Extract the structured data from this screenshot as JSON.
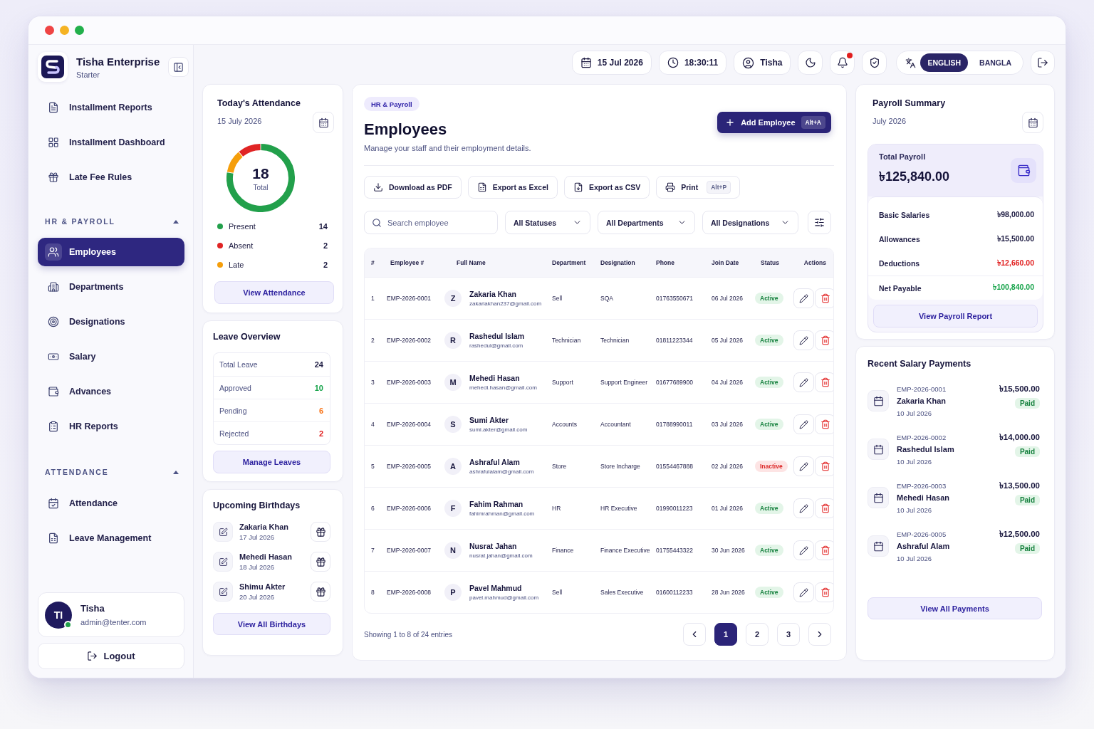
{
  "sidebar": {
    "brand": {
      "name": "Tisha Enterprise",
      "plan": "Starter"
    },
    "items": [
      {
        "label": "Installment Reports",
        "selected": false
      },
      {
        "label": "Installment Dashboard",
        "selected": false
      },
      {
        "label": "Late Fee Rules",
        "selected": false
      }
    ],
    "sections": [
      {
        "title": "HR & PAYROLL",
        "expanded": true,
        "items": [
          {
            "label": "Employees",
            "selected": true
          },
          {
            "label": "Departments",
            "selected": false
          },
          {
            "label": "Designations",
            "selected": false
          },
          {
            "label": "Salary",
            "selected": false
          },
          {
            "label": "Advances",
            "selected": false
          },
          {
            "label": "HR Reports",
            "selected": false
          }
        ]
      },
      {
        "title": "ATTENDANCE",
        "expanded": true,
        "items": [
          {
            "label": "Attendance",
            "selected": false
          },
          {
            "label": "Leave Management",
            "selected": false
          }
        ]
      }
    ],
    "user": {
      "initials": "TI",
      "name": "Tisha",
      "email": "admin@tenter.com",
      "online": true
    },
    "logout": "Logout"
  },
  "header": {
    "date": "15 Jul 2026",
    "time": "18:30:11",
    "user": "Tisha",
    "notifications_unread": true,
    "languages": [
      {
        "label": "ENGLISH",
        "selected": true
      },
      {
        "label": "BANGLA",
        "selected": false
      }
    ]
  },
  "attendance": {
    "title": "Today's Attendance",
    "date": "15 July 2026",
    "total": "18",
    "total_label": "Total",
    "items": [
      {
        "label": "Present",
        "value": "14",
        "color": "#22a04b"
      },
      {
        "label": "Absent",
        "value": "2",
        "color": "#e02424"
      },
      {
        "label": "Late",
        "value": "2",
        "color": "#f59e0b"
      }
    ],
    "button": "View Attendance"
  },
  "leave": {
    "title": "Leave Overview",
    "rows": [
      {
        "label": "Total Leave",
        "value": "24",
        "color": "#1b1940"
      },
      {
        "label": "Approved",
        "value": "10",
        "color": "#16a34a"
      },
      {
        "label": "Pending",
        "value": "6",
        "color": "#f97316"
      },
      {
        "label": "Rejected",
        "value": "2",
        "color": "#e11d1d"
      }
    ],
    "button": "Manage Leaves"
  },
  "birthdays": {
    "title": "Upcoming Birthdays",
    "items": [
      {
        "name": "Zakaria Khan",
        "date": "17 Jul 2026"
      },
      {
        "name": "Mehedi Hasan",
        "date": "18 Jul 2026"
      },
      {
        "name": "Shimu Akter",
        "date": "20 Jul 2026"
      }
    ],
    "button": "View All Birthdays"
  },
  "employees": {
    "badge": "HR & Payroll",
    "title": "Employees",
    "subtitle": "Manage your staff and their employment details.",
    "add_button": {
      "label": "Add Employee",
      "shortcut": "Alt+A"
    },
    "exports": [
      {
        "kind": "pdf",
        "label": "Download as PDF"
      },
      {
        "kind": "excel",
        "label": "Export as Excel"
      },
      {
        "kind": "csv",
        "label": "Export as CSV"
      },
      {
        "kind": "print",
        "label": "Print",
        "shortcut": "Alt+P"
      }
    ],
    "search": {
      "placeholder": "Search employee"
    },
    "filters": [
      "All Statuses",
      "All Departments",
      "All Designations"
    ],
    "table": {
      "columns": [
        "#",
        "Employee #",
        "Full Name",
        "Department",
        "Designation",
        "Phone",
        "Join Date",
        "Status",
        "Actions"
      ],
      "rows": [
        {
          "no": "1",
          "employee_id": "EMP-2026-0001",
          "initial": "Z",
          "name": "Zakaria Khan",
          "email": "zakariakhan237@gmail.com",
          "department": "Sell",
          "designation": "SQA",
          "phone": "01763550671",
          "join_date": "06 Jul 2026",
          "status": "Active",
          "active": true
        },
        {
          "no": "2",
          "employee_id": "EMP-2026-0002",
          "initial": "R",
          "name": "Rashedul Islam",
          "email": "rashedul@gmail.com",
          "department": "Technician",
          "designation": "Technician",
          "phone": "01811223344",
          "join_date": "05 Jul 2026",
          "status": "Active",
          "active": true
        },
        {
          "no": "3",
          "employee_id": "EMP-2026-0003",
          "initial": "M",
          "name": "Mehedi Hasan",
          "email": "mehedi.hasan@gmail.com",
          "department": "Support",
          "designation": "Support Engineer",
          "phone": "01677689900",
          "join_date": "04 Jul 2026",
          "status": "Active",
          "active": true
        },
        {
          "no": "4",
          "employee_id": "EMP-2026-0004",
          "initial": "S",
          "name": "Sumi Akter",
          "email": "sumi.akter@gmail.com",
          "department": "Accounts",
          "designation": "Accountant",
          "phone": "01788990011",
          "join_date": "03 Jul 2026",
          "status": "Active",
          "active": true
        },
        {
          "no": "5",
          "employee_id": "EMP-2026-0005",
          "initial": "A",
          "name": "Ashraful Alam",
          "email": "ashrafulalam@gmail.com",
          "department": "Store",
          "designation": "Store Incharge",
          "phone": "01554467888",
          "join_date": "02 Jul 2026",
          "status": "Inactive",
          "active": false
        },
        {
          "no": "6",
          "employee_id": "EMP-2026-0006",
          "initial": "F",
          "name": "Fahim Rahman",
          "email": "fahimrahman@gmail.com",
          "department": "HR",
          "designation": "HR Executive",
          "phone": "01990011223",
          "join_date": "01 Jul 2026",
          "status": "Active",
          "active": true
        },
        {
          "no": "7",
          "employee_id": "EMP-2026-0007",
          "initial": "N",
          "name": "Nusrat Jahan",
          "email": "nusrat.jahan@gmail.com",
          "department": "Finance",
          "designation": "Finance Executive",
          "phone": "01755443322",
          "join_date": "30 Jun 2026",
          "status": "Active",
          "active": true
        },
        {
          "no": "8",
          "employee_id": "EMP-2026-0008",
          "initial": "P",
          "name": "Pavel Mahmud",
          "email": "pavel.mahmud@gmail.com",
          "department": "Sell",
          "designation": "Sales Executive",
          "phone": "01600112233",
          "join_date": "28 Jun 2026",
          "status": "Active",
          "active": true
        }
      ]
    },
    "summary": "Showing 1 to 8 of 24 entries",
    "pages": [
      {
        "label": "1",
        "selected": true
      },
      {
        "label": "2",
        "selected": false
      },
      {
        "label": "3",
        "selected": false
      }
    ]
  },
  "payroll": {
    "title": "Payroll Summary",
    "period": "July 2026",
    "total_label": "Total Payroll",
    "total": "৳125,840.00",
    "rows": [
      {
        "kind": "item",
        "label": "Basic Salaries",
        "value": "৳98,000.00",
        "color": "#1b1940"
      },
      {
        "kind": "item",
        "label": "Allowances",
        "value": "৳15,500.00",
        "color": "#1b1940"
      },
      {
        "kind": "item",
        "label": "Deductions",
        "value": "৳12,660.00",
        "color": "#e11d1d"
      },
      {
        "kind": "net",
        "label": "Net Payable",
        "value": "৳100,840.00",
        "color": "#16a34a"
      }
    ],
    "button": "View Payroll Report"
  },
  "payments": {
    "title": "Recent Salary Payments",
    "items": [
      {
        "employee_id": "EMP-2026-0001",
        "name": "Zakaria Khan",
        "date": "10 Jul 2026",
        "amount": "৳15,500.00",
        "status": "Paid"
      },
      {
        "employee_id": "EMP-2026-0002",
        "name": "Rashedul Islam",
        "date": "10 Jul 2026",
        "amount": "৳14,000.00",
        "status": "Paid"
      },
      {
        "employee_id": "EMP-2026-0003",
        "name": "Mehedi Hasan",
        "date": "10 Jul 2026",
        "amount": "৳13,500.00",
        "status": "Paid"
      },
      {
        "employee_id": "EMP-2026-0005",
        "name": "Ashraful Alam",
        "date": "10 Jul 2026",
        "amount": "৳12,500.00",
        "status": "Paid"
      }
    ],
    "button": "View All Payments"
  }
}
